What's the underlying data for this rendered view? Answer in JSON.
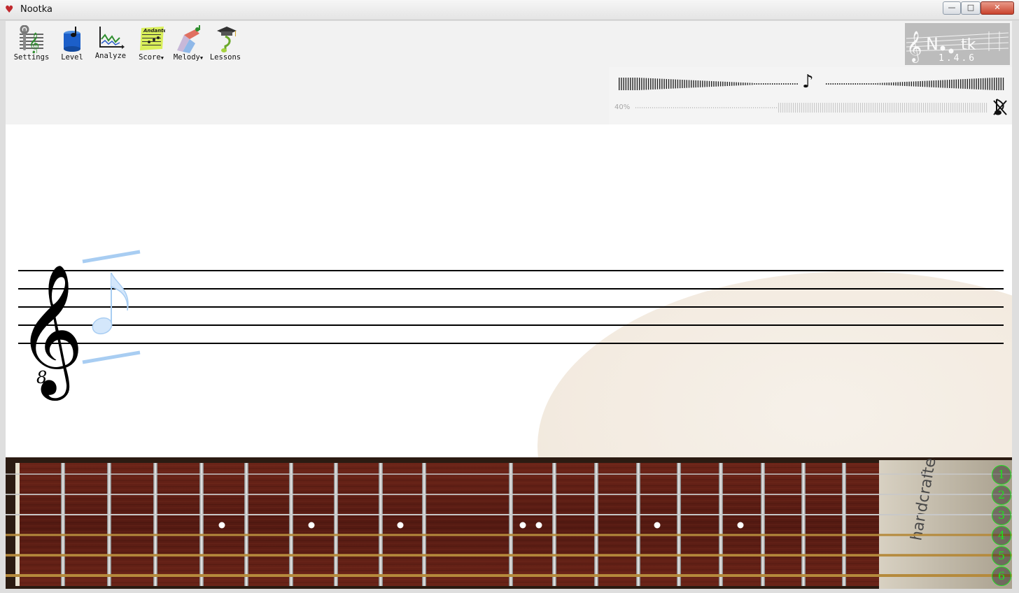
{
  "window": {
    "title": "Nootka",
    "icon": "heart-icon",
    "controls": [
      "minimize",
      "maximize",
      "close"
    ]
  },
  "toolbar": {
    "items": [
      {
        "label": "Settings",
        "icon": "settings-icon",
        "has_menu": false
      },
      {
        "label": "Level",
        "icon": "level-icon",
        "has_menu": false
      },
      {
        "label": "Analyze",
        "icon": "analyze-icon",
        "has_menu": false
      },
      {
        "label": "Score",
        "icon": "score-icon",
        "has_menu": true
      },
      {
        "label": "Melody",
        "icon": "melody-icon",
        "has_menu": true
      },
      {
        "label": "Lessons",
        "icon": "lessons-icon",
        "has_menu": false
      }
    ],
    "score_icon_text": "Andante"
  },
  "logo": {
    "letters": [
      "N",
      "tk"
    ],
    "version": "1.4.6"
  },
  "pitch_view": {
    "volume_label": "40%",
    "note_icon": "eighth-note-icon",
    "mute_icon": "mute-pitch-icon"
  },
  "score": {
    "clef": "treble-8vb-clef",
    "clef_sub": "8",
    "cursor_note": "eighth-note-cursor"
  },
  "fretboard": {
    "strings": [
      "1",
      "2",
      "3",
      "4",
      "5",
      "6"
    ],
    "decal_text": "handcrafted",
    "colors": {
      "wood": "#5b1f14",
      "string_number": "#20e020"
    }
  }
}
